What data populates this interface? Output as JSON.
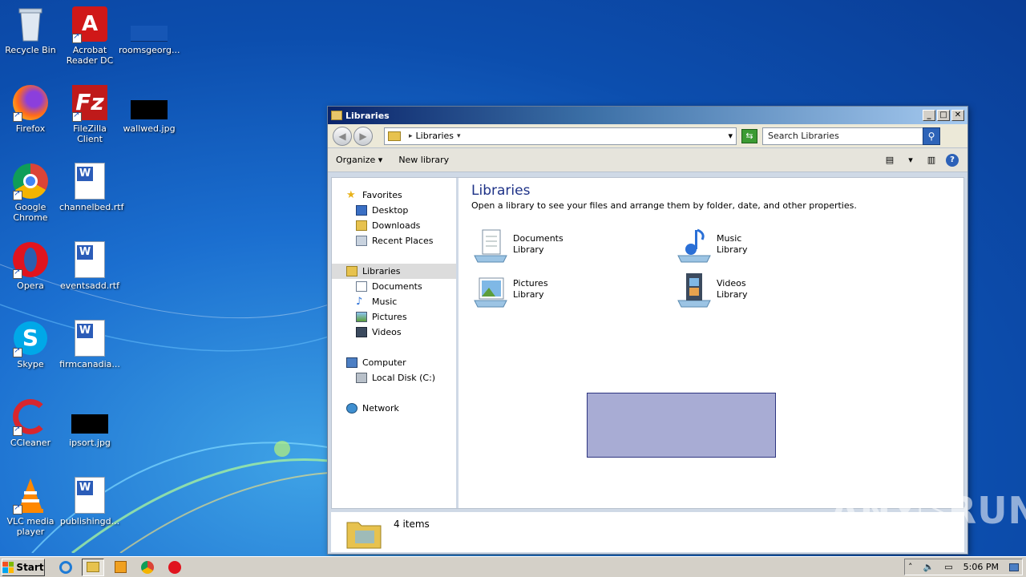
{
  "desktop": {
    "icons": [
      {
        "label": "Recycle Bin"
      },
      {
        "label": "Acrobat Reader DC"
      },
      {
        "label": "roomsgeorg..."
      },
      {
        "label": "Firefox"
      },
      {
        "label": "FileZilla Client"
      },
      {
        "label": "wallwed.jpg"
      },
      {
        "label": "Google Chrome"
      },
      {
        "label": "channelbed.rtf"
      },
      {
        "label": "Opera"
      },
      {
        "label": "eventsadd.rtf"
      },
      {
        "label": "Skype"
      },
      {
        "label": "firmcanadia..."
      },
      {
        "label": "CCleaner"
      },
      {
        "label": "ipsort.jpg"
      },
      {
        "label": "VLC media player"
      },
      {
        "label": "publishingd..."
      }
    ]
  },
  "window": {
    "title": "Libraries",
    "buttons": {
      "minimize": "_",
      "maximize": "□",
      "close": "✕"
    },
    "address": {
      "path": "Libraries",
      "sep": "▸",
      "dropdown": "▾"
    },
    "search": {
      "placeholder": "Search Libraries"
    },
    "toolbar": {
      "organize": "Organize ▾",
      "new_library": "New library",
      "help": "?"
    },
    "nav": {
      "favorites": "Favorites",
      "desktop": "Desktop",
      "downloads": "Downloads",
      "recent_places": "Recent Places",
      "libraries": "Libraries",
      "documents": "Documents",
      "music": "Music",
      "pictures": "Pictures",
      "videos": "Videos",
      "computer": "Computer",
      "local_disk": "Local Disk (C:)",
      "network": "Network"
    },
    "content": {
      "heading": "Libraries",
      "subtitle": "Open a library to see your files and arrange them by folder, date, and other properties.",
      "libraries": [
        {
          "name": "Documents",
          "kind": "Library"
        },
        {
          "name": "Music",
          "kind": "Library"
        },
        {
          "name": "Pictures",
          "kind": "Library"
        },
        {
          "name": "Videos",
          "kind": "Library"
        }
      ]
    },
    "details": {
      "count": "4 items"
    }
  },
  "taskbar": {
    "start": "Start",
    "clock": "5:06 PM"
  },
  "watermark": "ANY▷RUN"
}
